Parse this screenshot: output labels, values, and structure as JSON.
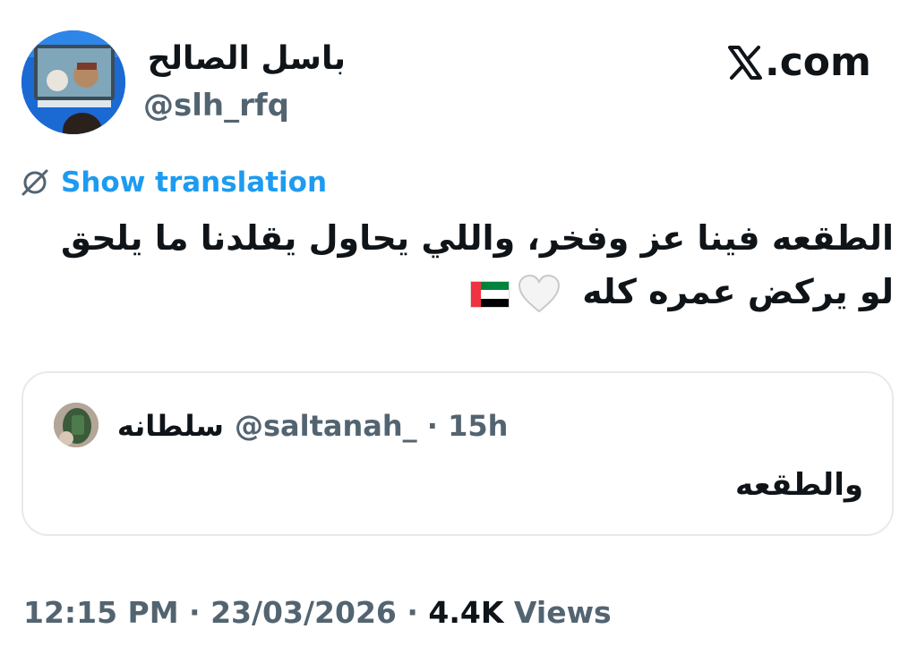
{
  "author": {
    "display_name": "باسل الصالح",
    "handle": "@slh_rfq"
  },
  "brand": {
    "site_label": ".com",
    "logo_icon": "x-logo-icon"
  },
  "translation": {
    "icon": "globe-slash-icon",
    "label": "Show translation",
    "color": "#1d9bf0"
  },
  "tweet": {
    "line1": "الطقعه فينا عز وفخر، واللي يحاول يقلدنا ما يلحق",
    "line2": "لو يركض عمره كله",
    "emojis": [
      "white-heart-icon",
      "uae-flag-icon"
    ]
  },
  "quoted": {
    "display_name": "سلطانه",
    "handle": "@saltanah_",
    "separator": " · ",
    "time": "15h",
    "text": "والطقعه"
  },
  "footer": {
    "time": "12:15 PM",
    "separator": " · ",
    "date": "23/03/2026",
    "views_count": "4.4K",
    "views_label": "Views"
  }
}
